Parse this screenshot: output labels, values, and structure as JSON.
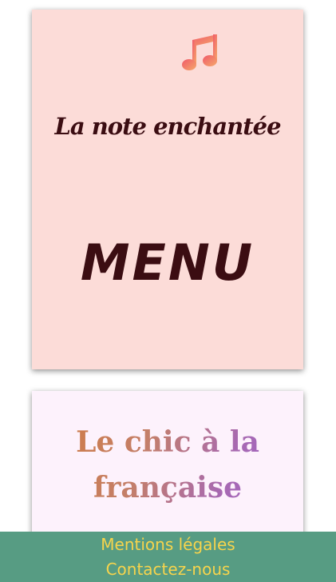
{
  "header_card": {
    "icon": "music-note-icon",
    "restaurant_name": "La note enchantée",
    "menu_title": "MENU"
  },
  "tagline_card": {
    "tagline": "Le chic à la française"
  },
  "footer": {
    "legal_label": "Mentions légales",
    "contact_label": "Contactez-nous"
  },
  "colors": {
    "header_card_bg": "#fcdcd8",
    "text_dark": "#3b0d12",
    "tagline_card_bg": "#fdf2fc",
    "footer_bg": "#579c83",
    "footer_text": "#f7d44c",
    "icon_gradient_start": "#f05a6a",
    "icon_gradient_end": "#f5a86a"
  }
}
